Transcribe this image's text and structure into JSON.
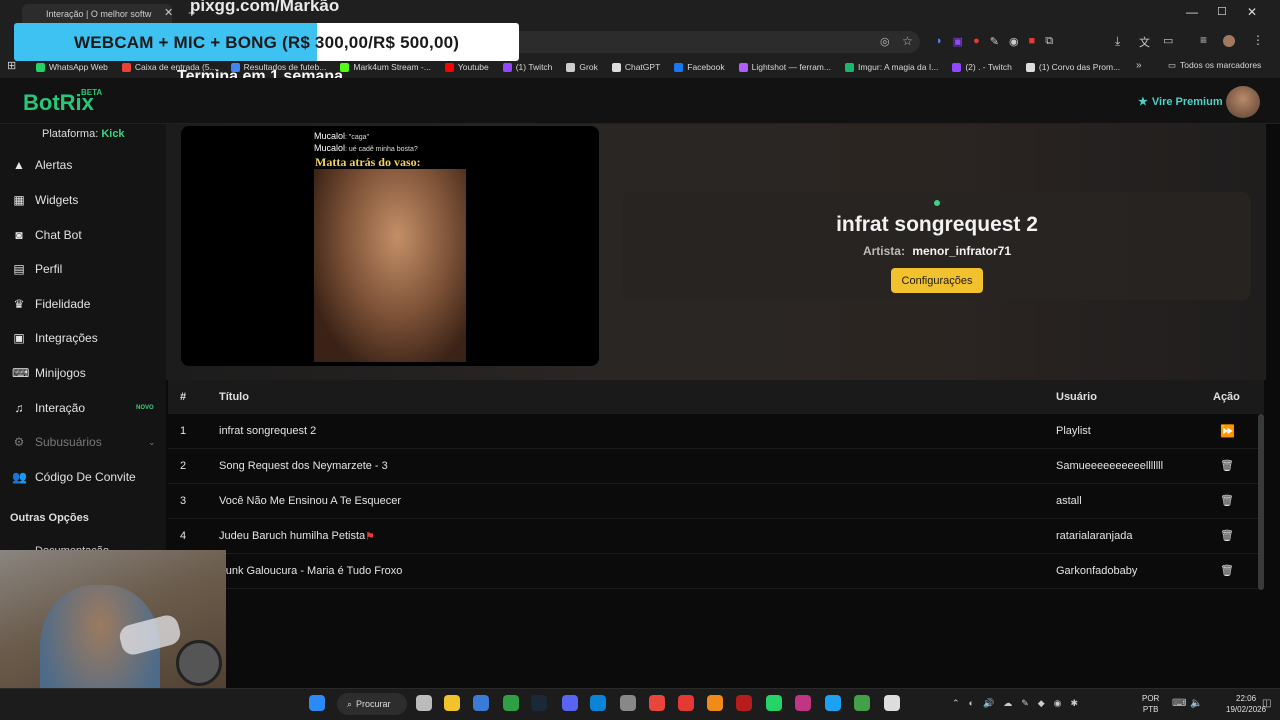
{
  "browser": {
    "tab_title": "Interação | O melhor softw",
    "bookmarks": [
      {
        "label": "WhatsApp Web",
        "color": "#25d366"
      },
      {
        "label": "Caixa de entrada (5...",
        "color": "#ea4335"
      },
      {
        "label": "Resultados de futeb...",
        "color": "#4285f4"
      },
      {
        "label": "Mark4um Stream -...",
        "color": "#53fc18"
      },
      {
        "label": "Youtube",
        "color": "#ff0000"
      },
      {
        "label": "(1) Twitch",
        "color": "#9146ff"
      },
      {
        "label": "Grok",
        "color": "#cccccc"
      },
      {
        "label": "ChatGPT",
        "color": "#dddddd"
      },
      {
        "label": "Facebook",
        "color": "#1877f2"
      },
      {
        "label": "Lightshot — ferram...",
        "color": "#b05cff"
      },
      {
        "label": "Imgur: A magia da I...",
        "color": "#1bb76e"
      },
      {
        "label": "(2) . - Twitch",
        "color": "#9146ff"
      },
      {
        "label": "(1) Corvo das Prom...",
        "color": "#dddddd"
      }
    ],
    "all_bookmarks_label": "Todos os marcadores"
  },
  "overlay": {
    "pix_url": "pixgg.com/Markão",
    "promo_text": "WEBCAM + MIC + BONG (R$ 300,00/R$ 500,00)",
    "ends_in": "Termina em 1 semana"
  },
  "app": {
    "logo": "BotRix",
    "beta": "BETA",
    "premium_label": "Vire Premium",
    "platform_label": "Plataforma:",
    "platform_value": "Kick",
    "nav": [
      {
        "label": "Alertas",
        "icon": "warning-icon"
      },
      {
        "label": "Widgets",
        "icon": "grid-icon"
      },
      {
        "label": "Chat Bot",
        "icon": "robot-icon"
      },
      {
        "label": "Perfil",
        "icon": "id-card-icon"
      },
      {
        "label": "Fidelidade",
        "icon": "trophy-icon"
      },
      {
        "label": "Integrações",
        "icon": "plug-icon"
      },
      {
        "label": "Minijogos",
        "icon": "gamepad-icon"
      },
      {
        "label": "Interação",
        "icon": "music-icon",
        "badge": "NOVO"
      },
      {
        "label": "Subusuários",
        "icon": "gears-icon"
      },
      {
        "label": "Código De Convite",
        "icon": "users-icon"
      }
    ],
    "other_options": "Outras Opções",
    "doc_link": "Documentação"
  },
  "player": {
    "meme_lines": [
      "Mucalol",
      ": \"caga\"",
      "Mucalol",
      ": ué cadê minha bosta?"
    ],
    "meme_title": "Matta atrás do vaso:",
    "song_title": "infrat songrequest 2",
    "artist_label": "Artista:",
    "artist_name": "menor_infrator71",
    "config_button": "Configurações"
  },
  "table": {
    "headers": {
      "num": "#",
      "title": "Título",
      "user": "Usuário",
      "action": "Ação"
    },
    "rows": [
      {
        "num": "1",
        "title": "infrat songrequest 2",
        "user": "Playlist",
        "action": "play"
      },
      {
        "num": "2",
        "title": "Song Request dos Neymarzete - 3",
        "user": "Samueeeeeeeeeelllllll",
        "action": "delete"
      },
      {
        "num": "3",
        "title": "Você Não Me Ensinou A Te Esquecer",
        "user": "astall",
        "action": "delete"
      },
      {
        "num": "4",
        "title": "Judeu Baruch humilha Petista",
        "user": "ratarialaranjada",
        "action": "delete",
        "flag": true
      },
      {
        "num": "5",
        "title": "Funk Galoucura - Maria é Tudo Froxo",
        "user": "Garkonfadobaby",
        "action": "delete"
      }
    ]
  },
  "taskbar": {
    "search_label": "Procurar",
    "lang_top": "POR",
    "lang_bottom": "PTB",
    "time": "22:06",
    "date": "19/02/2026"
  },
  "colors": {
    "accent_green": "#3ed17f",
    "config_yellow": "#f2c12e",
    "premium_teal": "#4fd1c5"
  }
}
